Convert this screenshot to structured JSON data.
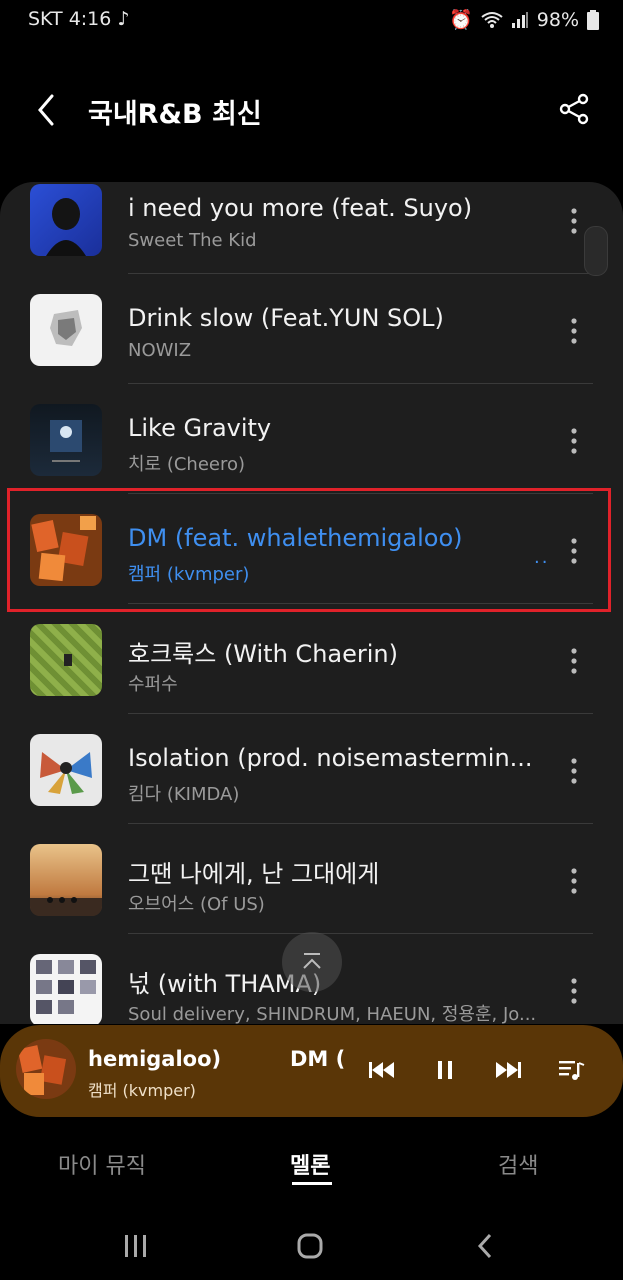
{
  "status": {
    "time": "SKT 4:16",
    "battery": "98%"
  },
  "header": {
    "title": "국내R&B 최신"
  },
  "tracks": [
    {
      "title": "i need you more (feat. Suyo)",
      "artist": "Sweet The Kid"
    },
    {
      "title": "Drink slow (Feat.YUN SOL)",
      "artist": "NOWIZ"
    },
    {
      "title": "Like Gravity",
      "artist": "치로 (Cheero)"
    },
    {
      "title": "DM (feat. whalethemigaloo)",
      "artist": "캠퍼 (kvmper)"
    },
    {
      "title": "호크룩스 (With Chaerin)",
      "artist": "수퍼수"
    },
    {
      "title": "Isolation (prod. noisemastermin...",
      "artist": "킴다 (KIMDA)"
    },
    {
      "title": "그땐 나에게, 난 그대에게",
      "artist": "오브어스 (Of US)"
    },
    {
      "title": "넋 (with THAMA)",
      "artist": "Soul delivery, SHINDRUM, HAEUN, 정용훈, Jo..."
    }
  ],
  "now_playing": {
    "title_part1": "hemigaloo)",
    "title_part2": "DM (",
    "artist": "캠퍼 (kvmper)"
  },
  "tabs": {
    "my_music": "마이 뮤직",
    "melon": "멜론",
    "search": "검색"
  },
  "colors": {
    "accent": "#3f8ff0",
    "player_bg": "#5a3607",
    "highlight": "#e0222a"
  }
}
